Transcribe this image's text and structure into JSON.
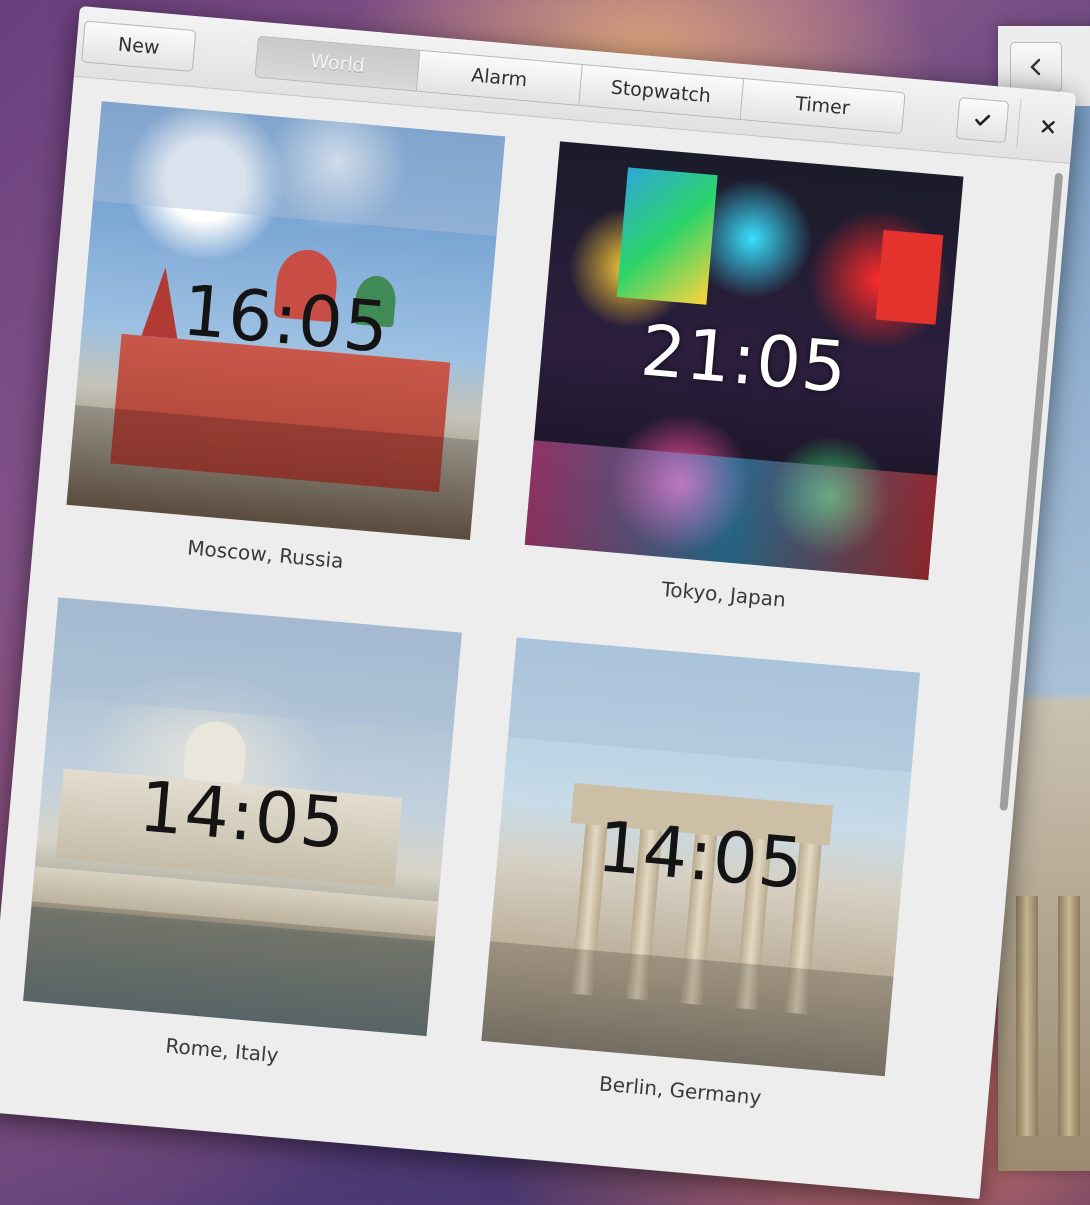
{
  "header": {
    "new_label": "New",
    "tabs": [
      {
        "label": "World",
        "active": true
      },
      {
        "label": "Alarm",
        "active": false
      },
      {
        "label": "Stopwatch",
        "active": false
      },
      {
        "label": "Timer",
        "active": false
      }
    ]
  },
  "icons": {
    "check": "checkmark-icon",
    "close": "close-icon",
    "back": "chevron-left-icon"
  },
  "clocks": [
    {
      "time": "16:05",
      "city": "Moscow, Russia"
    },
    {
      "time": "21:05",
      "city": "Tokyo, Japan"
    },
    {
      "time": "14:05",
      "city": "Rome, Italy"
    },
    {
      "time": "14:05",
      "city": "Berlin, Germany"
    }
  ]
}
